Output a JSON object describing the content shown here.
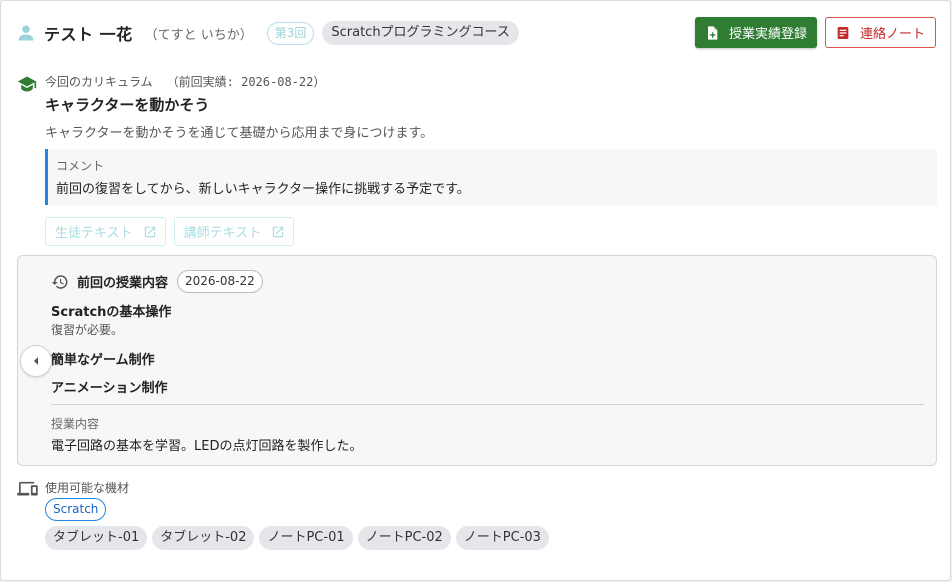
{
  "header": {
    "student_name": "テスト 一花",
    "student_kana": "（てすと いちか）",
    "lesson_count": "第3回",
    "course": "Scratchプログラミングコース",
    "register_button": "授業実績登録",
    "notebook_button": "連絡ノート"
  },
  "curriculum": {
    "label": "今回のカリキュラム",
    "previous_record": "（前回実績: 2026-08-22）",
    "title": "キャラクターを動かそう",
    "description": "キャラクターを動かそうを通じて基礎から応用まで身につけます。",
    "comment_label": "コメント",
    "comment_text": "前回の復習をしてから、新しいキャラクター操作に挑戦する予定です。",
    "student_text_button": "生徒テキスト",
    "teacher_text_button": "講師テキスト"
  },
  "previous_lesson": {
    "title": "前回の授業内容",
    "date": "2026-08-22",
    "topics": [
      {
        "name": "Scratchの基本操作",
        "note": "復習が必要。"
      },
      {
        "name": "簡単なゲーム制作",
        "note": ""
      },
      {
        "name": "アニメーション制作",
        "note": ""
      }
    ],
    "content_label": "授業内容",
    "content_text": "電子回路の基本を学習。LEDの点灯回路を製作した。"
  },
  "equipment": {
    "label": "使用可能な機材",
    "software": "Scratch",
    "devices": [
      "タブレット-01",
      "タブレット-02",
      "ノートPC-01",
      "ノートPC-02",
      "ノートPC-03"
    ]
  },
  "icons": {
    "person": "person-icon",
    "document_add": "document-add-icon",
    "notebook": "notebook-icon",
    "graduation": "graduation-cap-icon",
    "external_link": "external-link-icon",
    "history": "history-icon",
    "collapse": "chevron-left-icon",
    "devices": "devices-icon"
  },
  "colors": {
    "primary_green": "#2e7d32",
    "danger_red": "#c62828",
    "accent_blue": "#1e88e5",
    "teal_muted": "#a9dde2"
  }
}
